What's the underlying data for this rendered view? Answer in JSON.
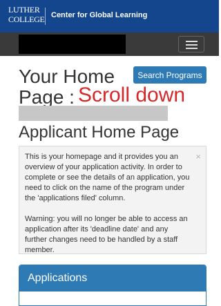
{
  "header": {
    "logo_line1": "LUTHER",
    "logo_line2": "COLLEGE",
    "site_name": "Center for Global Learning"
  },
  "nav": {
    "menu_icon": "hamburger-menu-icon"
  },
  "page": {
    "title": "Your Home Page :",
    "search_button": "Search Programs",
    "annotation": "Scroll down",
    "heading": "Applicant Home Page"
  },
  "info_box": {
    "paragraph1": "This is your homepage and it provides you an overview of your application activity. In order to complete or see the details of an application, you need to click on the name of the program under the 'applications filed' column.",
    "paragraph2": "Warning: you will no longer be able to access an application after its 'deadline date' and any further changes need to be handled by a staff member.",
    "close_label": "×"
  },
  "applications_panel": {
    "title": "Applications"
  },
  "colors": {
    "header_blue": "#13468d",
    "navbar_dark": "#3a3a3a",
    "accent_blue": "#2d7ab5",
    "annotation_red": "#d62828"
  }
}
